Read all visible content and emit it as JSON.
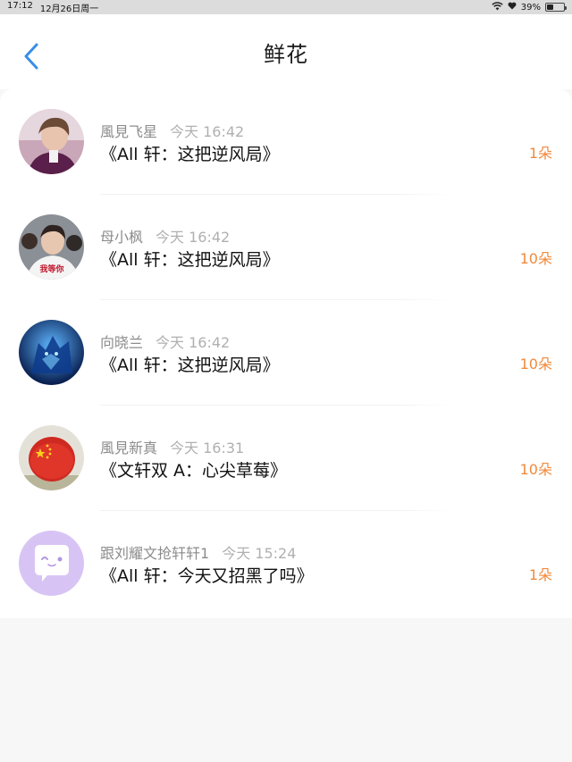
{
  "status_bar": {
    "time": "17:12",
    "date": "12月26日周一",
    "battery": "39%",
    "battery_level": 0.39
  },
  "header": {
    "title": "鲜花",
    "back_icon": "chevron-left-icon",
    "accent_color": "#3a8ee6"
  },
  "list": [
    {
      "user": "風見飞星",
      "time": "今天 16:42",
      "book": "《All 轩：这把逆风局》",
      "count": "1朵",
      "avatar": "photo-avatar"
    },
    {
      "user": "母小枫",
      "time": "今天 16:42",
      "book": "《All 轩：这把逆风局》",
      "count": "10朵",
      "avatar": "photo-avatar",
      "avatar_caption": "我等你"
    },
    {
      "user": "向晓兰",
      "time": "今天 16:42",
      "book": "《All 轩：这把逆风局》",
      "count": "10朵",
      "avatar": "blue-wolf-avatar"
    },
    {
      "user": "風見新真",
      "time": "今天 16:31",
      "book": "《文轩双 A：心尖草莓》",
      "count": "10朵",
      "avatar": "red-flag-avatar"
    },
    {
      "user": "跟刘耀文抢轩轩1",
      "time": "今天 15:24",
      "book": "《All 轩：今天又招黑了吗》",
      "count": "1朵",
      "avatar": "purple-chat-avatar"
    }
  ],
  "count_color": "#f08a3c"
}
